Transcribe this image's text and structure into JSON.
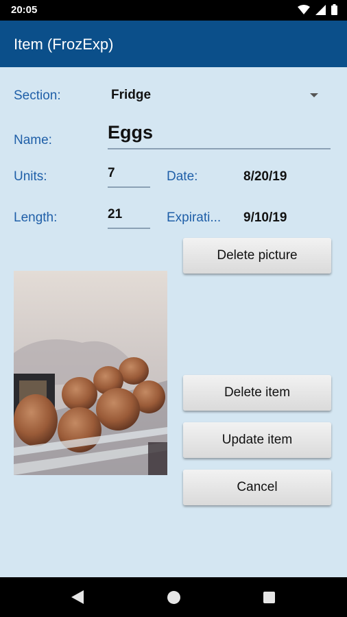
{
  "status_bar": {
    "time": "20:05"
  },
  "app_bar": {
    "title": "Item (FrozExp)"
  },
  "form": {
    "section_label": "Section:",
    "section_value": "Fridge",
    "name_label": "Name:",
    "name_value": "Eggs",
    "units_label": "Units:",
    "units_value": "7",
    "date_label": "Date:",
    "date_value": "8/20/19",
    "length_label": "Length:",
    "length_value": "21",
    "expiration_label": "Expirati...",
    "expiration_value": "9/10/19"
  },
  "buttons": {
    "delete_picture": "Delete picture",
    "delete_item": "Delete item",
    "update_item": "Update item",
    "cancel": "Cancel"
  },
  "colors": {
    "app_bar": "#0b4f8a",
    "background": "#d4e6f2",
    "label": "#1f5fa8"
  },
  "icons": [
    "wifi-icon",
    "signal-icon",
    "battery-icon",
    "back-icon",
    "home-icon",
    "recents-icon",
    "dropdown-arrow-icon"
  ]
}
